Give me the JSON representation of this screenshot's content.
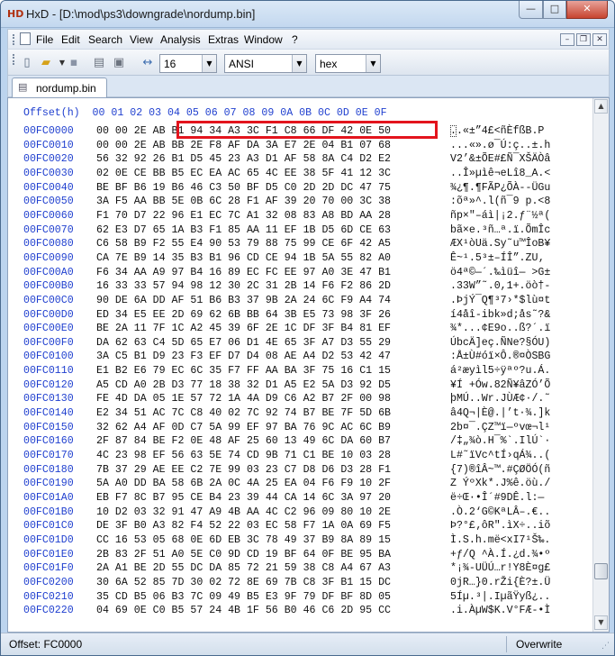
{
  "window": {
    "app_icon_text": "HD",
    "title": "HxD - [D:\\mod\\ps3\\downgrade\\nordump.bin]",
    "min_glyph": "—",
    "max_glyph": "□",
    "close_glyph": "✕"
  },
  "menu": {
    "items": [
      "File",
      "Edit",
      "Search",
      "View",
      "Analysis",
      "Extras",
      "Window",
      "?"
    ],
    "mdi_min": "–",
    "mdi_restore": "❐",
    "mdi_close": "✕"
  },
  "toolbar": {
    "icons": {
      "new": "new-file-icon",
      "open": "open-folder-icon",
      "save": "save-disk-icon",
      "ram": "open-ram-icon",
      "disk": "open-disk-icon",
      "cols": "bytes-per-row-icon"
    },
    "bytes_per_row": "16",
    "charset": "ANSI",
    "offset_base": "hex"
  },
  "tab": {
    "label": "nordump.bin"
  },
  "editor": {
    "header": "Offset(h)  00 01 02 03 04 05 06 07 08 09 0A 0B 0C 0D 0E 0F",
    "highlight_color": "#e3141d",
    "rows": [
      {
        "offset": "00FC0000",
        "hex": "00 00 2E AB B1 94 34 A3 3C F1 C8 66 DF 42 0E 50",
        "ascii": "..«±”4£<ñÈfßB.P"
      },
      {
        "offset": "00FC0010",
        "hex": "00 00 2E AB BB 2E F8 AF DA 3A E7 2E 04 B1 07 68",
        "ascii": "...«».ø¯Ú:ç..±.h"
      },
      {
        "offset": "00FC0020",
        "hex": "56 32 92 26 B1 D5 45 23 A3 D1 AF 58 8A C4 D2 E2",
        "ascii": "V2’&±ÕE#£Ñ¯XŠÄÒâ"
      },
      {
        "offset": "00FC0030",
        "hex": "02 0E CE BB B5 EC EA AC 65 4C EE 38 5F 41 12 3C",
        "ascii": "..Î»µìê¬eLî8_A.<"
      },
      {
        "offset": "00FC0040",
        "hex": "BE BF B6 19 B6 46 C3 50 BF D5 C0 2D 2D DC 47 75",
        "ascii": "¾¿¶.¶FÃP¿ÕÀ--ÜGu"
      },
      {
        "offset": "00FC0050",
        "hex": "3A F5 AA BB 5E 0B 6C 28 F1 AF 39 20 70 00 3C 38",
        "ascii": ":õª»^.l(ñ¯9 p.<8"
      },
      {
        "offset": "00FC0060",
        "hex": "F1 70 D7 22 96 E1 EC 7C A1 32 08 83 A8 BD AA 28",
        "ascii": "ñp×\"–áì|¡2.ƒ¨½ª("
      },
      {
        "offset": "00FC0070",
        "hex": "62 E3 D7 65 1A B3 F1 85 AA 11 EF 1B D5 6D CE 63",
        "ascii": "bã×e.³ñ…ª.ï.ÕmÎc"
      },
      {
        "offset": "00FC0080",
        "hex": "C6 58 B9 F2 55 E4 90 53 79 88 75 99 CE 6F 42 A5",
        "ascii": "ÆX¹òUä.Sy˜u™ÎoB¥"
      },
      {
        "offset": "00FC0090",
        "hex": "CA 7E B9 14 35 B3 B1 96 CD CE 94 1B 5A 55 82 A0",
        "ascii": "Ê~¹.5³±–ÍÎ”.ZU‚ "
      },
      {
        "offset": "00FC00A0",
        "hex": "F6 34 AA A9 97 B4 16 89 EC FC EE 97 A0 3E 47 B1",
        "ascii": "ö4ª©—´.‰ìüî— >G±"
      },
      {
        "offset": "00FC00B0",
        "hex": "16 33 33 57 94 98 12 30 2C 31 2B 14 F6 F2 86 2D",
        "ascii": ".33W”˜.0,1+.öò†-"
      },
      {
        "offset": "00FC00C0",
        "hex": "90 DE 6A DD AF 51 B6 B3 37 9B 2A 24 6C F9 A4 74",
        "ascii": ".ÞjÝ¯Q¶³7›*$lù¤t"
      },
      {
        "offset": "00FC00D0",
        "hex": "ED 34 E5 EE 2D 69 62 6B BB 64 3B E5 73 98 3F 26",
        "ascii": "í4åî-ibk»d;ås˜?&"
      },
      {
        "offset": "00FC00E0",
        "hex": "BE 2A 11 7F 1C A2 45 39 6F 2E 1C DF 3F B4 81 EF",
        "ascii": "¾*...¢E9o..ß?´.ï"
      },
      {
        "offset": "00FC00F0",
        "hex": "DA 62 63 C4 5D 65 E7 06 D1 4E 65 3F A7 D3 55 29",
        "ascii": "ÚbcÄ]eç.ÑNe?§ÓU)"
      },
      {
        "offset": "00FC0100",
        "hex": "3A C5 B1 D9 23 F3 EF D7 D4 08 AE A4 D2 53 42 47",
        "ascii": ":Å±Ù#óï×Ô.®¤ÒSBG"
      },
      {
        "offset": "00FC0110",
        "hex": "E1 B2 E6 79 EC 6C 35 F7 FF AA BA 3F 75 16 C1 15",
        "ascii": "á²æyìl5÷ÿªº?u.Á."
      },
      {
        "offset": "00FC0120",
        "hex": "A5 CD A0 2B D3 77 18 38 32 D1 A5 E2 5A D3 92 D5",
        "ascii": "¥Í +Ów.82Ñ¥âZÓ’Õ"
      },
      {
        "offset": "00FC0130",
        "hex": "FE 4D DA 05 1E 57 72 1A 4A D9 C6 A2 B7 2F 00 98",
        "ascii": "þMÚ..Wr.JÙÆ¢·/.˜"
      },
      {
        "offset": "00FC0140",
        "hex": "E2 34 51 AC 7C C8 40 02 7C 92 74 B7 BE 7F 5D 6B",
        "ascii": "â4Q¬|È@.|’t·¾.]k"
      },
      {
        "offset": "00FC0150",
        "hex": "32 62 A4 AF 0D C7 5A 99 EF 97 BA 76 9C AC 6C B9",
        "ascii": "2b¤¯.ÇZ™ï—ºvœ¬l¹"
      },
      {
        "offset": "00FC0160",
        "hex": "2F 87 84 BE F2 0E 48 AF 25 60 13 49 6C DA 60 B7",
        "ascii": "/‡„¾ò.H¯%`.IlÚ`·"
      },
      {
        "offset": "00FC0170",
        "hex": "4C 23 98 EF 56 63 5E 74 CD 9B 71 C1 BE 10 03 28",
        "ascii": "L#˜ïVc^tÍ›qÁ¾..("
      },
      {
        "offset": "00FC0180",
        "hex": "7B 37 29 AE EE C2 7E 99 03 23 C7 D8 D6 D3 28 F1",
        "ascii": "{7)®îÂ~™.#ÇØÖÓ(ñ"
      },
      {
        "offset": "00FC0190",
        "hex": "5A A0 DD BA 58 6B 2A 0C 4A 25 EA 04 F6 F9 10 2F",
        "ascii": "Z ÝºXk*.J%ê.öù./"
      },
      {
        "offset": "00FC01A0",
        "hex": "EB F7 8C B7 95 CE B4 23 39 44 CA 14 6C 3A 97 20",
        "ascii": "ë÷Œ·•Î´#9DÊ.l:— "
      },
      {
        "offset": "00FC01B0",
        "hex": "10 D2 03 32 91 47 A9 4B AA 4C C2 96 09 80 10 2E",
        "ascii": ".Ò.2‘G©KªLÂ–.€.."
      },
      {
        "offset": "00FC01C0",
        "hex": "DE 3F B0 A3 82 F4 52 22 03 EC 58 F7 1A 0A 69 F5",
        "ascii": "Þ?°£‚ôR\".ìX÷..iõ"
      },
      {
        "offset": "00FC01D0",
        "hex": "CC 16 53 05 68 0E 6D EB 3C 78 49 37 B9 8A 89 15",
        "ascii": "Ì.S.h.më<xI7¹Š‰."
      },
      {
        "offset": "00FC01E0",
        "hex": "2B 83 2F 51 A0 5E C0 9D CD 19 BF 64 0F BE 95 BA",
        "ascii": "+ƒ/Q ^À.Í.¿d.¾•º"
      },
      {
        "offset": "00FC01F0",
        "hex": "2A A1 BE 2D 55 DC DA 85 72 21 59 38 C8 A4 67 A3",
        "ascii": "*¡¾-UÜÚ…r!Y8È¤g£"
      },
      {
        "offset": "00FC0200",
        "hex": "30 6A 52 85 7D 30 02 72 8E 69 7B C8 3F B1 15 DC",
        "ascii": "0jR…}0.rŽi{È?±.Ü"
      },
      {
        "offset": "00FC0210",
        "hex": "35 CD B5 06 B3 7C 09 49 B5 E3 9F 79 DF BF 8D 05",
        "ascii": "5Íµ.³|.IµãŸyß¿.."
      },
      {
        "offset": "00FC0220",
        "hex": "04 69 0E C0 B5 57 24 4B 1F 56 B0 46 C6 2D 95 CC",
        "ascii": ".i.ÀµW$K.V°FÆ-•Ì"
      }
    ]
  },
  "scrollbar": {
    "up": "▲",
    "down": "▼",
    "position": 0.93
  },
  "status": {
    "offset": "Offset: FC0000",
    "mode": "Overwrite"
  }
}
